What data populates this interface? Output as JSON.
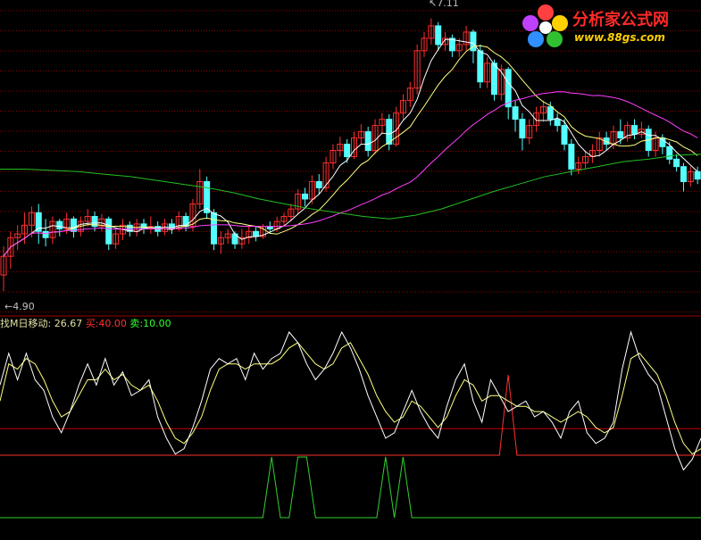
{
  "price_panel": {
    "high_label": "7.11",
    "low_label": "4.90",
    "y_range": [
      4.75,
      7.2
    ],
    "colors": {
      "up": "#ff3030",
      "down": "#54ffff",
      "ma_short": "#ffffff",
      "ma_mid": "#ffff80",
      "ma_long": "#ff40ff",
      "ma_longest": "#22c022",
      "grid": "#8b0000"
    },
    "candles": [
      [
        5.05,
        5.2,
        4.92,
        5.28
      ],
      [
        5.2,
        5.35,
        5.1,
        5.4
      ],
      [
        5.35,
        5.38,
        5.25,
        5.45
      ],
      [
        5.38,
        5.45,
        5.3,
        5.55
      ],
      [
        5.45,
        5.55,
        5.35,
        5.6
      ],
      [
        5.55,
        5.4,
        5.3,
        5.62
      ],
      [
        5.4,
        5.35,
        5.28,
        5.5
      ],
      [
        5.35,
        5.48,
        5.3,
        5.52
      ],
      [
        5.48,
        5.42,
        5.36,
        5.5
      ],
      [
        5.42,
        5.5,
        5.38,
        5.55
      ],
      [
        5.5,
        5.4,
        5.35,
        5.52
      ],
      [
        5.4,
        5.48,
        5.36,
        5.52
      ],
      [
        5.48,
        5.52,
        5.44,
        5.58
      ],
      [
        5.52,
        5.44,
        5.4,
        5.56
      ],
      [
        5.44,
        5.5,
        5.4,
        5.54
      ],
      [
        5.5,
        5.3,
        5.25,
        5.52
      ],
      [
        5.3,
        5.38,
        5.26,
        5.42
      ],
      [
        5.38,
        5.45,
        5.33,
        5.5
      ],
      [
        5.45,
        5.4,
        5.36,
        5.48
      ],
      [
        5.4,
        5.46,
        5.36,
        5.5
      ],
      [
        5.46,
        5.42,
        5.38,
        5.5
      ],
      [
        5.42,
        5.44,
        5.38,
        5.52
      ],
      [
        5.44,
        5.4,
        5.36,
        5.48
      ],
      [
        5.4,
        5.46,
        5.37,
        5.5
      ],
      [
        5.46,
        5.42,
        5.38,
        5.5
      ],
      [
        5.42,
        5.52,
        5.4,
        5.56
      ],
      [
        5.52,
        5.44,
        5.4,
        5.55
      ],
      [
        5.44,
        5.62,
        5.4,
        5.66
      ],
      [
        5.62,
        5.8,
        5.58,
        5.9
      ],
      [
        5.8,
        5.55,
        5.5,
        5.84
      ],
      [
        5.55,
        5.3,
        5.25,
        5.58
      ],
      [
        5.3,
        5.35,
        5.22,
        5.4
      ],
      [
        5.35,
        5.38,
        5.3,
        5.42
      ],
      [
        5.38,
        5.3,
        5.26,
        5.4
      ],
      [
        5.3,
        5.35,
        5.26,
        5.42
      ],
      [
        5.35,
        5.4,
        5.3,
        5.44
      ],
      [
        5.4,
        5.36,
        5.32,
        5.44
      ],
      [
        5.36,
        5.44,
        5.34,
        5.46
      ],
      [
        5.44,
        5.42,
        5.38,
        5.48
      ],
      [
        5.42,
        5.48,
        5.4,
        5.52
      ],
      [
        5.48,
        5.52,
        5.44,
        5.55
      ],
      [
        5.52,
        5.58,
        5.48,
        5.62
      ],
      [
        5.58,
        5.7,
        5.54,
        5.74
      ],
      [
        5.7,
        5.66,
        5.6,
        5.75
      ],
      [
        5.66,
        5.8,
        5.62,
        5.85
      ],
      [
        5.8,
        5.75,
        5.7,
        5.86
      ],
      [
        5.75,
        5.95,
        5.72,
        6.0
      ],
      [
        5.95,
        6.05,
        5.9,
        6.1
      ],
      [
        6.05,
        6.1,
        6.0,
        6.16
      ],
      [
        6.1,
        6.0,
        5.95,
        6.14
      ],
      [
        6.0,
        6.15,
        5.98,
        6.2
      ],
      [
        6.15,
        6.2,
        6.1,
        6.26
      ],
      [
        6.2,
        6.05,
        6.0,
        6.24
      ],
      [
        6.05,
        6.25,
        6.02,
        6.3
      ],
      [
        6.25,
        6.3,
        6.18,
        6.35
      ],
      [
        6.3,
        6.1,
        6.05,
        6.34
      ],
      [
        6.1,
        6.35,
        6.08,
        6.4
      ],
      [
        6.35,
        6.45,
        6.3,
        6.5
      ],
      [
        6.45,
        6.55,
        6.4,
        6.6
      ],
      [
        6.55,
        6.85,
        6.5,
        6.9
      ],
      [
        6.85,
        6.95,
        6.8,
        7.0
      ],
      [
        6.95,
        7.05,
        6.9,
        7.11
      ],
      [
        7.05,
        6.9,
        6.85,
        7.08
      ],
      [
        6.9,
        6.95,
        6.85,
        7.0
      ],
      [
        6.95,
        6.85,
        6.8,
        6.98
      ],
      [
        6.85,
        6.9,
        6.8,
        6.95
      ],
      [
        6.9,
        7.0,
        6.85,
        7.05
      ],
      [
        7.0,
        6.85,
        6.75,
        7.02
      ],
      [
        6.85,
        6.6,
        6.55,
        6.9
      ],
      [
        6.6,
        6.75,
        6.55,
        6.8
      ],
      [
        6.75,
        6.5,
        6.45,
        6.78
      ],
      [
        6.5,
        6.7,
        6.45,
        6.74
      ],
      [
        6.7,
        6.4,
        6.3,
        6.72
      ],
      [
        6.4,
        6.3,
        6.2,
        6.45
      ],
      [
        6.3,
        6.15,
        6.05,
        6.35
      ],
      [
        6.15,
        6.25,
        6.1,
        6.3
      ],
      [
        6.25,
        6.35,
        6.2,
        6.4
      ],
      [
        6.35,
        6.4,
        6.28,
        6.45
      ],
      [
        6.4,
        6.3,
        6.25,
        6.44
      ],
      [
        6.3,
        6.25,
        6.2,
        6.35
      ],
      [
        6.25,
        6.1,
        6.05,
        6.3
      ],
      [
        6.1,
        5.9,
        5.85,
        6.14
      ],
      [
        5.9,
        5.95,
        5.86,
        6.0
      ],
      [
        5.95,
        6.0,
        5.9,
        6.05
      ],
      [
        6.0,
        6.05,
        5.95,
        6.1
      ],
      [
        6.05,
        6.15,
        6.0,
        6.2
      ],
      [
        6.15,
        6.1,
        6.05,
        6.2
      ],
      [
        6.1,
        6.2,
        6.06,
        6.25
      ],
      [
        6.2,
        6.15,
        6.1,
        6.3
      ],
      [
        6.15,
        6.25,
        6.12,
        6.28
      ],
      [
        6.25,
        6.18,
        6.14,
        6.3
      ],
      [
        6.18,
        6.22,
        6.15,
        6.28
      ],
      [
        6.22,
        6.05,
        6.0,
        6.25
      ],
      [
        6.05,
        6.15,
        6.0,
        6.2
      ],
      [
        6.15,
        6.08,
        6.02,
        6.18
      ],
      [
        6.08,
        5.98,
        5.94,
        6.12
      ],
      [
        5.98,
        5.92,
        5.88,
        6.02
      ],
      [
        5.92,
        5.8,
        5.72,
        5.95
      ],
      [
        5.8,
        5.88,
        5.76,
        5.92
      ],
      [
        5.88,
        5.82,
        5.78,
        5.92
      ]
    ],
    "ma_longest": [
      5.9,
      5.9,
      5.89,
      5.88,
      5.86,
      5.84,
      5.81,
      5.78,
      5.75,
      5.71,
      5.66,
      5.62,
      5.58,
      5.55,
      5.52,
      5.5,
      5.53,
      5.58,
      5.65,
      5.72,
      5.78,
      5.84,
      5.88,
      5.92,
      5.96,
      5.98,
      6.01,
      6.02
    ]
  },
  "indicator_panel": {
    "name": "找M日移动:",
    "value": "26.67",
    "buy_label": "买:",
    "buy_value": "40.00",
    "sell_label": "卖:",
    "sell_value": "10.00",
    "colors": {
      "name": "#e0e0a0",
      "buy": "#ff3030",
      "sell": "#30ff30",
      "line_main": "#ffffff",
      "line_signal": "#ffff80",
      "level_line": "#c00000",
      "sell_line": "#30d030"
    },
    "y_range": [
      0,
      70
    ],
    "buy_level": 40,
    "sell_level": 10,
    "main_line": [
      50,
      62,
      52,
      62,
      52,
      48,
      38,
      32,
      40,
      50,
      58,
      50,
      60,
      50,
      55,
      46,
      48,
      52,
      38,
      30,
      24,
      26,
      34,
      44,
      56,
      60,
      58,
      60,
      52,
      62,
      56,
      60,
      62,
      70,
      66,
      58,
      52,
      56,
      62,
      70,
      64,
      56,
      46,
      38,
      30,
      32,
      40,
      48,
      40,
      34,
      30,
      42,
      52,
      58,
      44,
      36,
      52,
      46,
      40,
      42,
      44,
      38,
      40,
      36,
      30,
      40,
      44,
      32,
      28,
      30,
      36,
      56,
      70,
      60,
      54,
      50,
      38,
      26,
      18,
      22,
      30
    ],
    "signal_line": [
      44,
      58,
      56,
      60,
      58,
      52,
      44,
      38,
      40,
      46,
      52,
      52,
      56,
      52,
      54,
      50,
      48,
      50,
      44,
      36,
      30,
      28,
      32,
      38,
      48,
      56,
      58,
      58,
      56,
      58,
      58,
      58,
      60,
      64,
      66,
      62,
      58,
      56,
      58,
      64,
      66,
      60,
      54,
      46,
      40,
      36,
      38,
      44,
      42,
      38,
      34,
      38,
      46,
      52,
      50,
      44,
      46,
      46,
      44,
      42,
      42,
      40,
      40,
      38,
      36,
      38,
      40,
      38,
      34,
      32,
      34,
      46,
      60,
      62,
      58,
      54,
      46,
      36,
      28,
      24,
      26
    ],
    "buy_signal": [
      0,
      0,
      0,
      0,
      0,
      0,
      0,
      0,
      0,
      0,
      0,
      0,
      0,
      0,
      0,
      0,
      0,
      0,
      0,
      0,
      0,
      0,
      0,
      0,
      0,
      0,
      0,
      0,
      0,
      0,
      0,
      0,
      0,
      0,
      0,
      0,
      0,
      0,
      0,
      0,
      0,
      0,
      0,
      0,
      0,
      0,
      0,
      0,
      0,
      0,
      0,
      0,
      0,
      0,
      0,
      0,
      0,
      0,
      1,
      0,
      0,
      0,
      0,
      0,
      0,
      0,
      0,
      0,
      0,
      0,
      0,
      0,
      0,
      0,
      0,
      0,
      0,
      0,
      0,
      0,
      0
    ],
    "sell_signal": [
      0,
      0,
      0,
      0,
      0,
      0,
      0,
      0,
      0,
      0,
      0,
      0,
      0,
      0,
      0,
      0,
      0,
      0,
      0,
      0,
      0,
      0,
      0,
      0,
      0,
      0,
      0,
      0,
      0,
      0,
      0,
      1,
      0,
      0,
      1,
      1,
      0,
      0,
      0,
      0,
      0,
      0,
      0,
      0,
      1,
      0,
      1,
      0,
      0,
      0,
      0,
      0,
      0,
      0,
      0,
      0,
      0,
      0,
      0,
      0,
      0,
      0,
      0,
      0,
      0,
      0,
      0,
      0,
      0,
      0,
      0,
      0,
      0,
      0,
      0,
      0,
      0,
      0,
      0,
      0,
      0
    ]
  },
  "logo": {
    "cn": "分析家公式网",
    "url": "www.88gs.com"
  }
}
